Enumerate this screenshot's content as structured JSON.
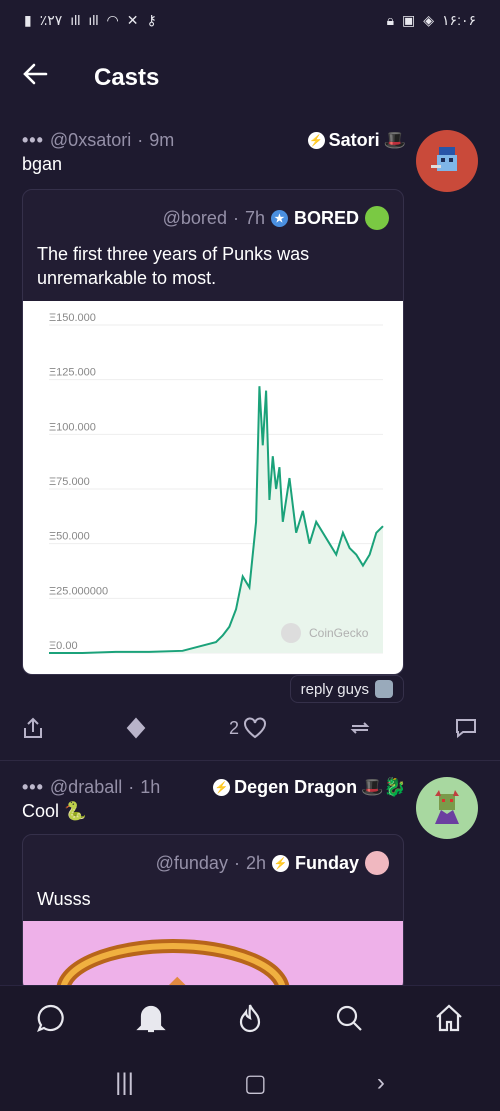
{
  "status_bar": {
    "left": "٪۲۷",
    "time": "۱۶:۰۶"
  },
  "header": {
    "title": "Casts"
  },
  "casts": [
    {
      "dots": "•••",
      "handle": "@0xsatori",
      "sep": "·",
      "age": "9m",
      "author": "Satori",
      "author_emoji": "🎩",
      "text": "bgan",
      "embed": {
        "handle": "@bored",
        "sep": "·",
        "age": "7h",
        "name": "BORED",
        "text": "The first three years of Punks was unremarkable to most."
      },
      "reply_guys_label": "reply guys",
      "reply_count": "2"
    },
    {
      "dots": "•••",
      "handle": "@draball",
      "sep": "·",
      "age": "1h",
      "author": "Degen Dragon",
      "author_emoji": "🎩🐉",
      "text": "Cool 🐍",
      "embed": {
        "handle": "@funday",
        "sep": "·",
        "age": "2h",
        "name": "Funday",
        "text": "Wusss"
      }
    }
  ],
  "chart_data": {
    "type": "line",
    "title": "",
    "xlabel": "",
    "ylabel": "",
    "yticks": [
      "Ξ150.000",
      "Ξ125.000",
      "Ξ100.000",
      "Ξ75.000",
      "Ξ50.000",
      "Ξ25.000000",
      "Ξ0.00"
    ],
    "ylim": [
      0,
      150
    ],
    "watermark": "CoinGecko",
    "series": [
      {
        "color": "#1ba27a",
        "x": [
          0,
          10,
          20,
          30,
          40,
          45,
          50,
          52,
          54,
          56,
          58,
          60,
          62,
          63,
          64,
          65,
          66,
          67,
          68,
          69,
          70,
          72,
          74,
          76,
          78,
          80,
          82,
          84,
          86,
          88,
          90,
          92,
          94,
          96,
          98,
          100
        ],
        "values": [
          0,
          0,
          0.5,
          0.5,
          1,
          3,
          5,
          8,
          12,
          20,
          35,
          30,
          60,
          122,
          95,
          120,
          70,
          90,
          75,
          85,
          60,
          80,
          55,
          65,
          50,
          60,
          55,
          50,
          45,
          55,
          48,
          45,
          40,
          45,
          55,
          58
        ]
      }
    ],
    "grid": true
  },
  "colors": {
    "background": "#1e1a2f",
    "line": "#1ba27a",
    "muted": "#9590a8"
  }
}
